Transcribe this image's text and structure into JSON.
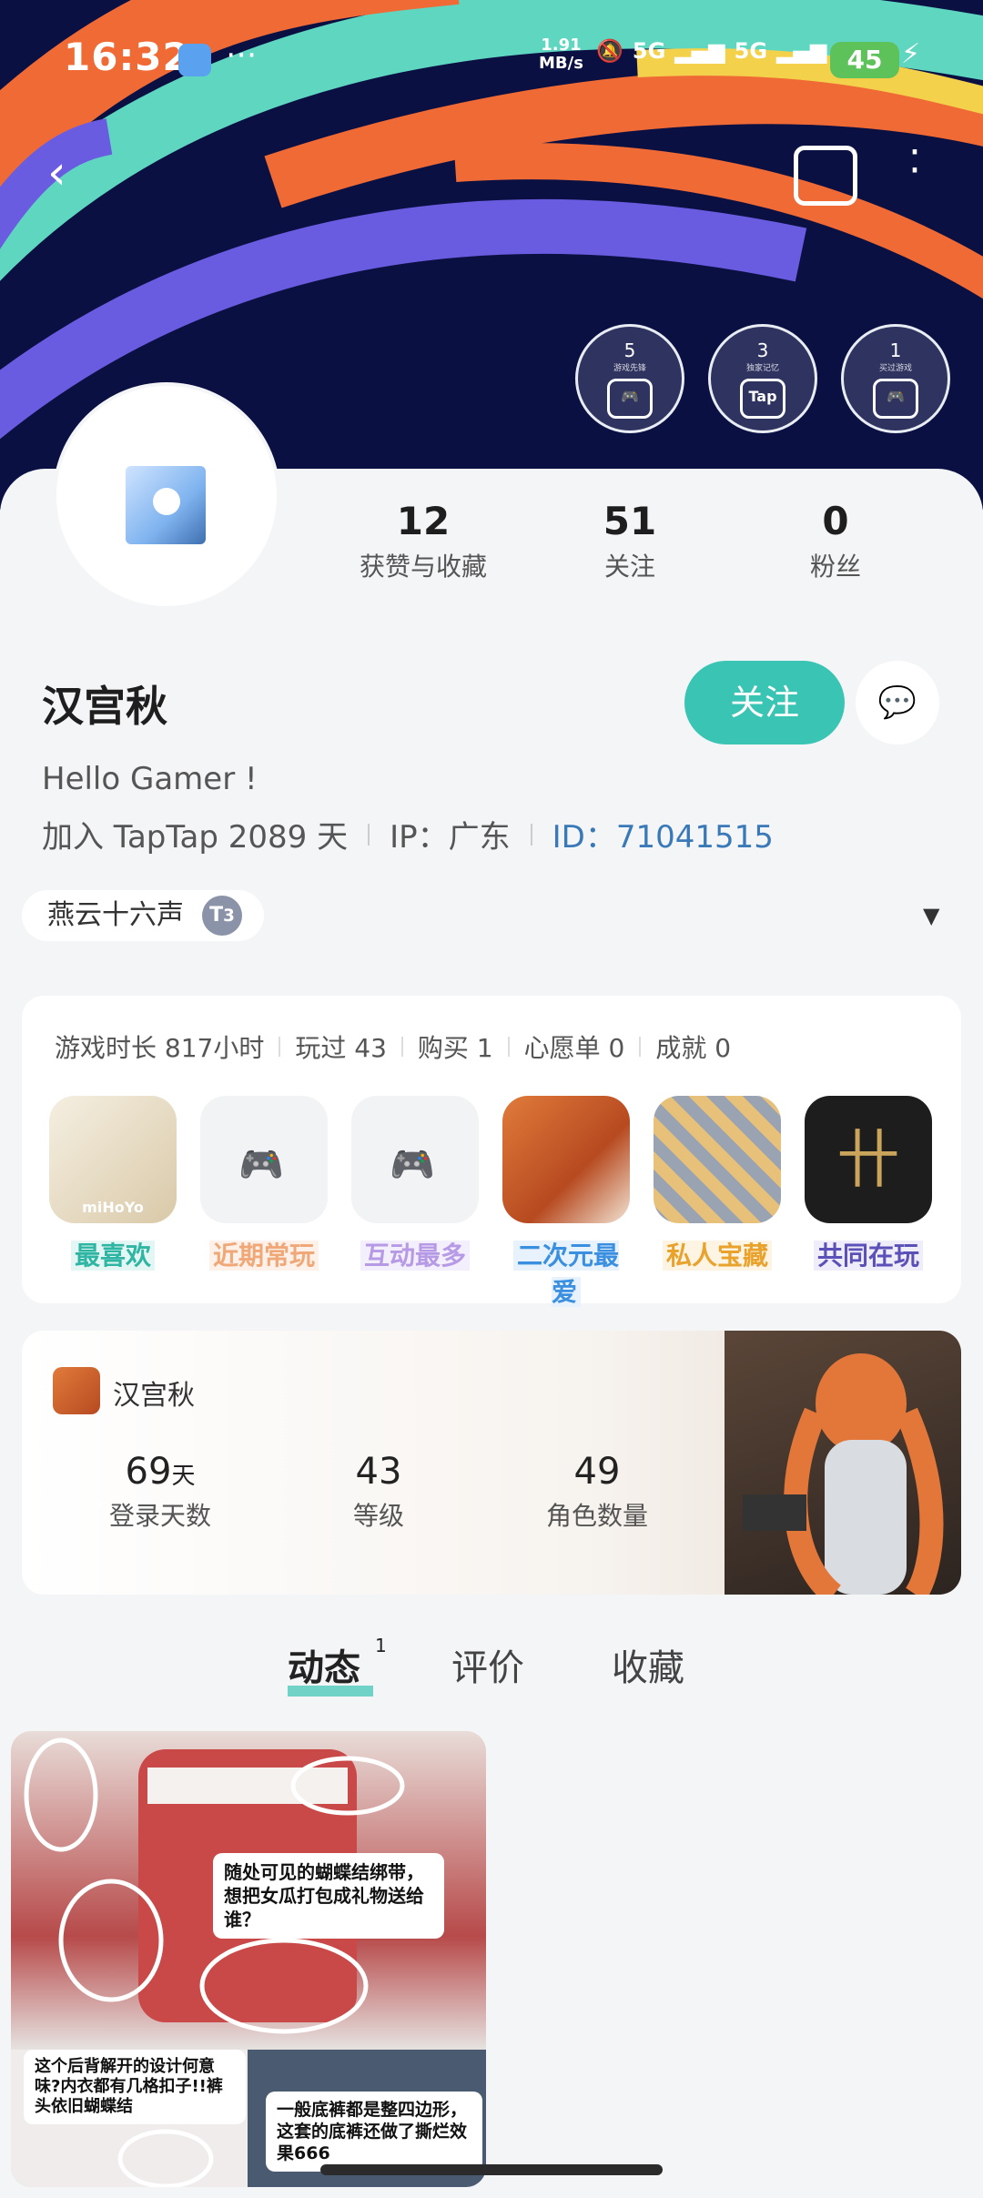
{
  "status_bar": {
    "time": "16:32",
    "net_speed": "1.91",
    "net_unit": "MB/s",
    "signal1": "5G",
    "signal2": "5G",
    "battery": "45"
  },
  "badges": [
    {
      "num": "5",
      "caption": "游戏先锋",
      "icon": "calendar-gamepad-icon"
    },
    {
      "num": "3",
      "caption": "独家记忆",
      "icon": "tap-icon"
    },
    {
      "num": "1",
      "caption": "买过游戏",
      "icon": "bag-gamepad-icon"
    }
  ],
  "stats": [
    {
      "value": "12",
      "label": "获赞与收藏"
    },
    {
      "value": "51",
      "label": "关注"
    },
    {
      "value": "0",
      "label": "粉丝"
    }
  ],
  "profile": {
    "name": "汉宫秋",
    "follow_label": "关注",
    "bio": "Hello Gamer !",
    "joined": "加入 TapTap 2089 天",
    "ip": "IP：广东",
    "id": "ID：71041515",
    "title": "燕云十六声",
    "title_level": "3"
  },
  "games": {
    "stats": [
      "游戏时长 817小时",
      "玩过 43",
      "购买 1",
      "心愿单 0",
      "成就 0"
    ],
    "items": [
      {
        "label": "最喜欢",
        "color": "#2fb5a3"
      },
      {
        "label": "近期常玩",
        "color": "#f0a878"
      },
      {
        "label": "互动最多",
        "color": "#b69ae6"
      },
      {
        "label": "二次元最爱",
        "color": "#3a8fe0"
      },
      {
        "label": "私人宝藏",
        "color": "#e9a22c"
      },
      {
        "label": "共同在玩",
        "color": "#5b50b8"
      }
    ],
    "first_icon_text": "miHoYo"
  },
  "character": {
    "name": "汉宫秋",
    "stats": [
      {
        "value": "69",
        "unit": "天",
        "label": "登录天数"
      },
      {
        "value": "43",
        "unit": "",
        "label": "等级"
      },
      {
        "value": "49",
        "unit": "",
        "label": "角色数量"
      }
    ]
  },
  "tabs": [
    {
      "label": "动态",
      "count": "1"
    },
    {
      "label": "评价",
      "count": ""
    },
    {
      "label": "收藏",
      "count": ""
    }
  ],
  "post": {
    "notes": [
      "随处可见的蝴蝶结绑带，想把女瓜打包成礼物送给谁？",
      "这个后背解开的设计何意味?内衣都有几格扣子!!裤头依旧蝴蝶结",
      "一般底裤都是整四边形，这套的底裤还做了撕烂效果666"
    ]
  }
}
